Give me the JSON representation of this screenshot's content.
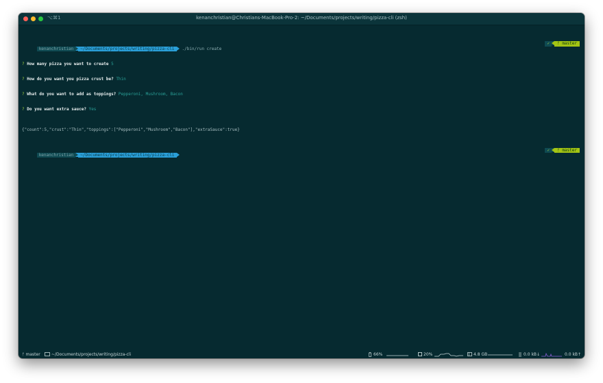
{
  "window": {
    "shortcut": "⌥⌘1",
    "title": "kenanchristian@Christians-MacBook-Pro-2: ~/Documents/projects/writing/pizza-cli (zsh)"
  },
  "terminal": {
    "prompt1": {
      "user": "kenanchristian",
      "path": "~/Documents/projects/writing/pizza-cli",
      "command": "./bin/run create",
      "status": "✓",
      "branch": "ᚠ master"
    },
    "qa": [
      {
        "mark": "?",
        "question": "How many pizza you want to create",
        "answer": "5"
      },
      {
        "mark": "?",
        "question": "How do you want you pizza crust be?",
        "answer": "Thin"
      },
      {
        "mark": "?",
        "question": "What do you want to add as toppings?",
        "answer": "Pepperoni, Mushroom, Bacon"
      },
      {
        "mark": "?",
        "question": "Do you want extra sauce?",
        "answer": "Yes"
      }
    ],
    "json_output": "{\"count\":5,\"crust\":\"Thin\",\"toppings\":[\"Pepperoni\",\"Mushroom\",\"Bacon\"],\"extraSauce\":true}",
    "prompt2": {
      "user": "kenanchristian",
      "path": "~/Documents/projects/writing/pizza-cli",
      "status": "✓",
      "branch": "ᚠ master"
    }
  },
  "statusbar": {
    "git_branch": "ᚠ master",
    "folder_icon": "folder-icon",
    "path": "~/Documents/projects/writing/pizza-cli",
    "battery_icon": "battery-icon",
    "battery": "66%",
    "cpu_icon": "cpu-icon",
    "cpu": "20%",
    "memory_icon": "memory-icon",
    "memory": "4.8 GB",
    "network_icon": "network-icon",
    "net_down": "0.0 kB↓",
    "net_up": "0.0 kB↑"
  },
  "colors": {
    "background": "#062a30",
    "path_segment": "#2a9fd8",
    "branch_segment": "#a3c414",
    "question_mark": "#a3d13f",
    "answer": "#2aa198"
  }
}
